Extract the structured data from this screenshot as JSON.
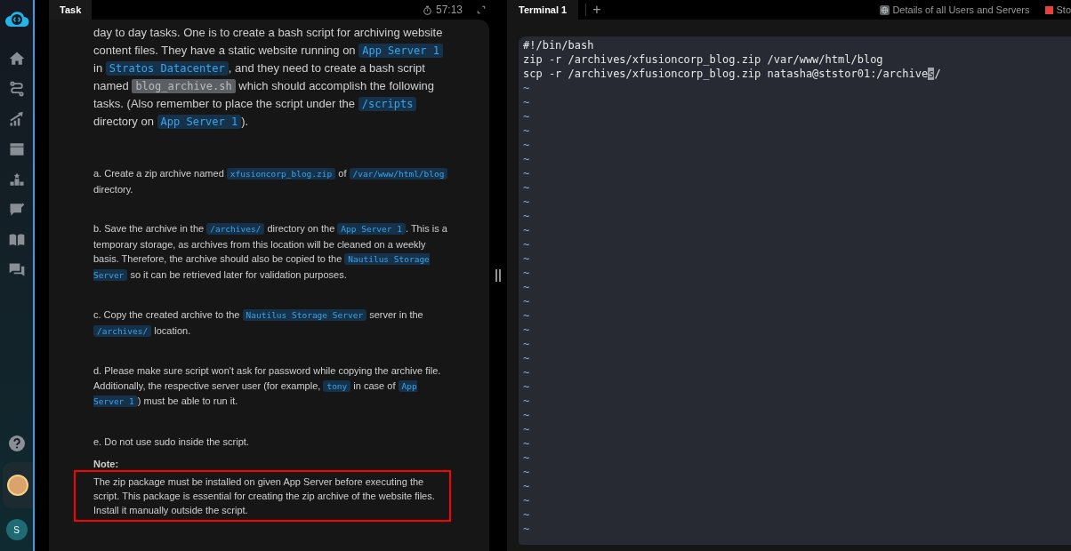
{
  "sidebar": {
    "user_initial": "S"
  },
  "task_panel": {
    "tab": {
      "label": "Task",
      "selected": true
    },
    "timer": "57:13",
    "intro": [
      {
        "kind": "text",
        "text": "day to day tasks. One is to create a bash script for archiving website content files. They have a static website running on "
      },
      {
        "kind": "code",
        "text": "App Server 1"
      },
      {
        "kind": "text",
        "text": " in "
      },
      {
        "kind": "code",
        "text": "Stratos Datacenter"
      },
      {
        "kind": "text",
        "text": ", and they need to create a bash script named "
      },
      {
        "kind": "selected-code",
        "text": "blog_archive.sh"
      },
      {
        "kind": "text",
        "text": " which should accomplish the following tasks. (Also remember to place the script under the "
      },
      {
        "kind": "code",
        "text": "/scripts"
      },
      {
        "kind": "text",
        "text": " directory on "
      },
      {
        "kind": "code",
        "text": "App Server 1"
      },
      {
        "kind": "text",
        "text": ")."
      }
    ],
    "items": [
      [
        {
          "kind": "text",
          "text": "a. Create a zip archive named "
        },
        {
          "kind": "code",
          "text": "xfusioncorp_blog.zip"
        },
        {
          "kind": "text",
          "text": " of "
        },
        {
          "kind": "code",
          "text": "/var/www/html/blog"
        },
        {
          "kind": "text",
          "text": " directory."
        }
      ],
      [
        {
          "kind": "text",
          "text": "b. Save the archive in the "
        },
        {
          "kind": "code",
          "text": "/archives/"
        },
        {
          "kind": "text",
          "text": " directory on the "
        },
        {
          "kind": "code",
          "text": "App Server 1"
        },
        {
          "kind": "text",
          "text": ". This is a temporary storage, as archives from this location will be cleaned on a weekly basis. Therefore, the archive should also be copied to the "
        },
        {
          "kind": "code",
          "text": "Nautilus Storage Server"
        },
        {
          "kind": "text",
          "text": " so it can be retrieved later for validation purposes."
        }
      ],
      [
        {
          "kind": "text",
          "text": "c. Copy the created archive to the "
        },
        {
          "kind": "code",
          "text": "Nautilus Storage Server"
        },
        {
          "kind": "text",
          "text": " server in the "
        },
        {
          "kind": "code",
          "text": "/archives/"
        },
        {
          "kind": "text",
          "text": " location."
        }
      ],
      [
        {
          "kind": "text",
          "text": "d. Please make sure script won't ask for password while copying the archive file. Additionally, the respective server user (for example, "
        },
        {
          "kind": "code",
          "text": "tony"
        },
        {
          "kind": "text",
          "text": " in case of "
        },
        {
          "kind": "code",
          "text": "App Server 1"
        },
        {
          "kind": "text",
          "text": ") must be able to run it."
        }
      ],
      [
        {
          "kind": "text",
          "text": "e. Do not use sudo inside the script."
        }
      ]
    ],
    "note": {
      "label": "Note:",
      "text": "The zip package must be installed on given App Server before executing the script. This package is essential for creating the zip archive of the website files. Install it manually outside the script.",
      "highlighted": true
    }
  },
  "terminal_panel": {
    "tabs": [
      {
        "label": "Terminal 1",
        "selected": true
      }
    ],
    "add_tab": "+",
    "links": [
      {
        "kind": "globe",
        "label": "Details of all Users and Servers"
      },
      {
        "kind": "stop",
        "label": "Sto"
      }
    ],
    "lines": [
      {
        "text": "#!/bin/bash"
      },
      {
        "text": "zip -r /archives/xfusioncorp_blog.zip /var/www/html/blog"
      },
      {
        "text": "scp -r /archives/xfusioncorp_blog.zip natasha@ststor01:/archive",
        "cursor": "s",
        "after": "/"
      }
    ],
    "empty_markers": [
      "~",
      "~",
      "~",
      "~",
      "~",
      "~",
      "~",
      "~",
      "~",
      "~",
      "~",
      "~",
      "~",
      "~",
      "~",
      "~",
      "~",
      "~",
      "~",
      "~",
      "~",
      "~",
      "~",
      "~",
      "~",
      "~",
      "~",
      "~",
      "~",
      "~",
      "~",
      "~"
    ]
  }
}
